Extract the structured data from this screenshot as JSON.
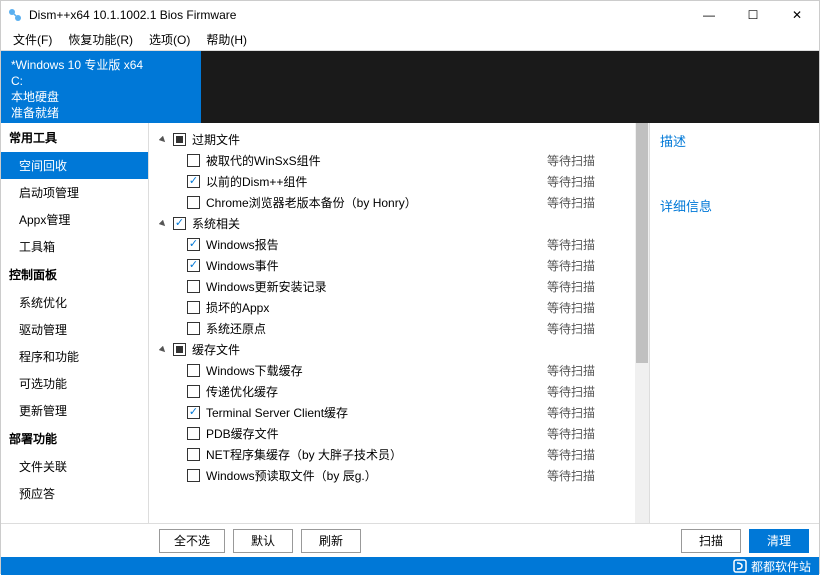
{
  "window": {
    "title": "Dism++x64 10.1.1002.1 Bios Firmware"
  },
  "menu": {
    "file": "文件(F)",
    "recovery": "恢复功能(R)",
    "options": "选项(O)",
    "help": "帮助(H)"
  },
  "info": {
    "line1": "*Windows 10 专业版 x64",
    "line2": "C:",
    "line3": "本地硬盘",
    "line4": "准备就绪"
  },
  "sidebar": {
    "section1": "常用工具",
    "items1": [
      "空间回收",
      "启动项管理",
      "Appx管理",
      "工具箱"
    ],
    "section2": "控制面板",
    "items2": [
      "系统优化",
      "驱动管理",
      "程序和功能",
      "可选功能",
      "更新管理"
    ],
    "section3": "部署功能",
    "items3": [
      "文件关联",
      "预应答"
    ]
  },
  "groups": [
    {
      "label": "过期文件",
      "state": "partial",
      "items": [
        {
          "label": "被取代的WinSxS组件",
          "status": "等待扫描",
          "checked": false
        },
        {
          "label": "以前的Dism++组件",
          "status": "等待扫描",
          "checked": true
        },
        {
          "label": "Chrome浏览器老版本备份（by Honry）",
          "status": "等待扫描",
          "checked": false
        }
      ]
    },
    {
      "label": "系统相关",
      "state": "checked",
      "items": [
        {
          "label": "Windows报告",
          "status": "等待扫描",
          "checked": true
        },
        {
          "label": "Windows事件",
          "status": "等待扫描",
          "checked": true
        },
        {
          "label": "Windows更新安装记录",
          "status": "等待扫描",
          "checked": false
        },
        {
          "label": "损坏的Appx",
          "status": "等待扫描",
          "checked": false
        },
        {
          "label": "系统还原点",
          "status": "等待扫描",
          "checked": false
        }
      ]
    },
    {
      "label": "缓存文件",
      "state": "partial",
      "items": [
        {
          "label": "Windows下载缓存",
          "status": "等待扫描",
          "checked": false
        },
        {
          "label": "传递优化缓存",
          "status": "等待扫描",
          "checked": false
        },
        {
          "label": "Terminal Server Client缓存",
          "status": "等待扫描",
          "checked": true
        },
        {
          "label": "PDB缓存文件",
          "status": "等待扫描",
          "checked": false
        },
        {
          "label": "NET程序集缓存（by 大胖子技术员）",
          "status": "等待扫描",
          "checked": false
        },
        {
          "label": "Windows预读取文件（by 辰g.）",
          "status": "等待扫描",
          "checked": false
        }
      ]
    }
  ],
  "desc": {
    "title": "描述",
    "detail": "详细信息"
  },
  "buttons": {
    "none": "全不选",
    "default": "默认",
    "refresh": "刷新",
    "scan": "扫描",
    "clean": "清理"
  },
  "footer": {
    "brand": "都都软件站"
  }
}
